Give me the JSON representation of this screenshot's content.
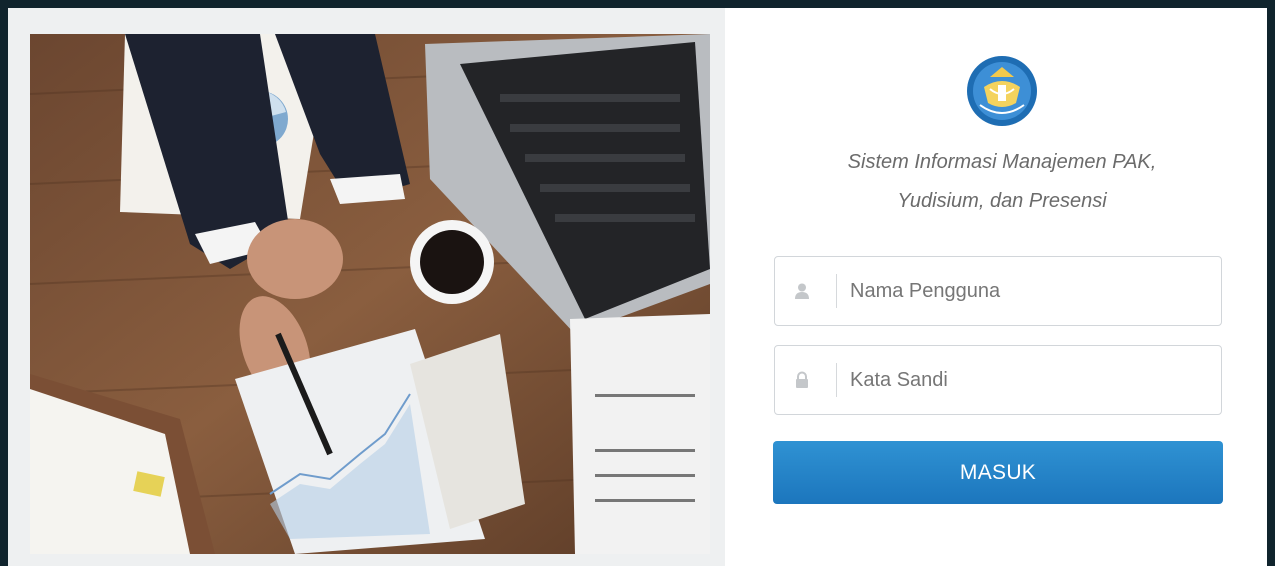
{
  "header": {
    "title_line1": "Sistem Informasi Manajemen PAK,",
    "title_line2": "Yudisium, dan Presensi"
  },
  "logo": {
    "icon": "kemdikbud-tut-wuri-handayani-emblem"
  },
  "form": {
    "username": {
      "icon": "user-icon",
      "placeholder": "Nama Pengguna",
      "value": ""
    },
    "password": {
      "icon": "lock-icon",
      "placeholder": "Kata Sandi",
      "value": ""
    },
    "submit_label": "MASUK"
  },
  "colors": {
    "background_dark": "#10242d",
    "button": "#1f7dc4",
    "title_text": "#6b6b6b"
  },
  "hero_image": {
    "subject": "business-desk-photo"
  }
}
